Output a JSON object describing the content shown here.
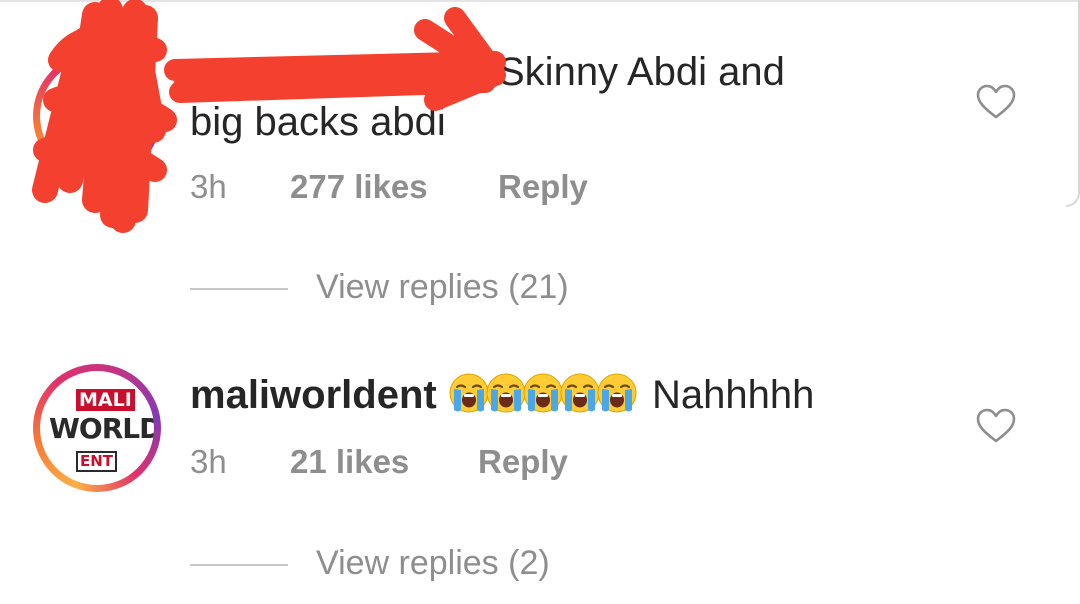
{
  "comments": [
    {
      "username": "",
      "text_line1": "Skinny Abdi and",
      "text_line2": "big backs abdi",
      "time": "3h",
      "likes": "277 likes",
      "reply": "Reply",
      "view_replies": "View replies (21)",
      "avatar_redacted": true,
      "heart_icon": "heart-outline-icon"
    },
    {
      "username": "maliworldent",
      "emoji": [
        "loudly-crying-face",
        "loudly-crying-face",
        "loudly-crying-face",
        "loudly-crying-face",
        "loudly-crying-face"
      ],
      "text": "Nahhhhh",
      "time": "3h",
      "likes": "21 likes",
      "reply": "Reply",
      "view_replies": "View replies (2)",
      "avatar_logo": {
        "line1": "MALI",
        "line2": "WORLD",
        "line3": "ENT"
      },
      "heart_icon": "heart-outline-icon"
    }
  ],
  "colors": {
    "text": "#262626",
    "meta": "#8e8e8e",
    "redaction": "#f4402f",
    "logo_red": "#c8102e"
  }
}
